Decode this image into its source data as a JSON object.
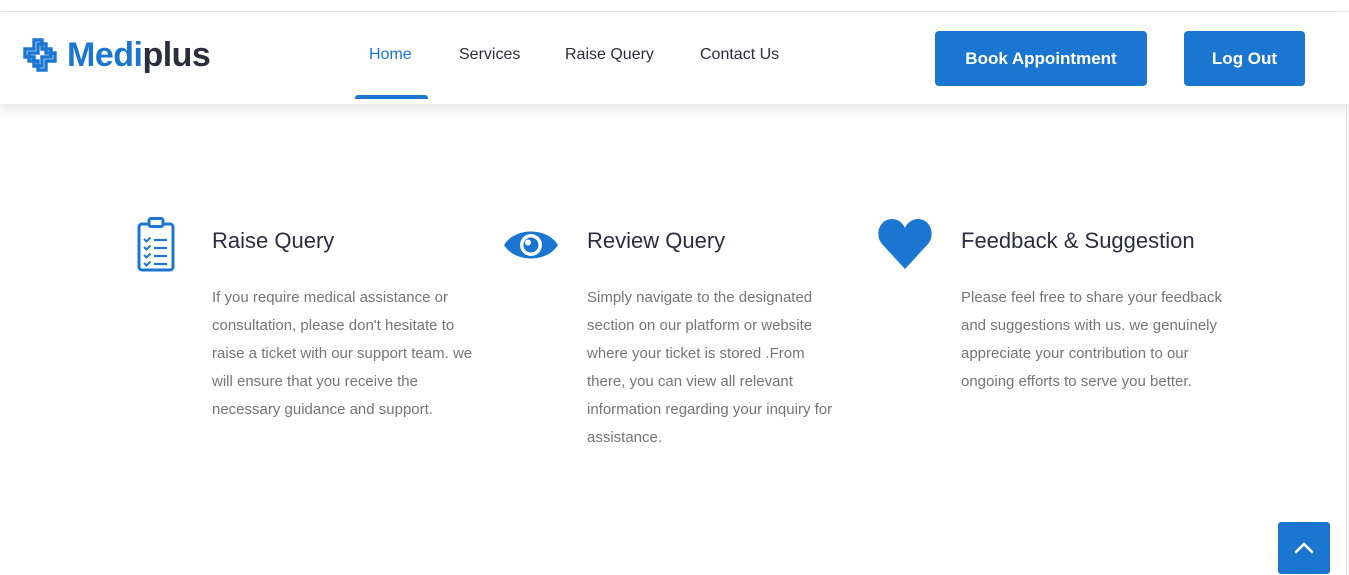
{
  "brand": {
    "name_part1": "Medi",
    "name_part2": "plus",
    "accent_color": "#1a76d1"
  },
  "nav": {
    "items": [
      {
        "label": "Home",
        "active": true
      },
      {
        "label": "Services",
        "active": false
      },
      {
        "label": "Raise Query",
        "active": false
      },
      {
        "label": "Contact Us",
        "active": false
      }
    ]
  },
  "header_buttons": {
    "book": "Book Appointment",
    "logout": "Log Out"
  },
  "features": [
    {
      "icon": "clipboard-checklist-icon",
      "title": "Raise Query",
      "text": "If you require medical assistance or consultation, please don't hesitate to raise a ticket with our support team. we will ensure that you receive the necessary guidance and support."
    },
    {
      "icon": "eye-icon",
      "title": "Review Query",
      "text": "Simply navigate to the designated section on our platform or website where your ticket is stored .From there, you can view all relevant information regarding your inquiry for assistance."
    },
    {
      "icon": "heart-icon",
      "title": "Feedback & Suggestion",
      "text": "Please feel free to share your feedback and suggestions with us. we genuinely appreciate your contribution to our ongoing efforts to serve you better."
    }
  ],
  "scroll_top": {
    "icon": "chevron-up-icon"
  }
}
